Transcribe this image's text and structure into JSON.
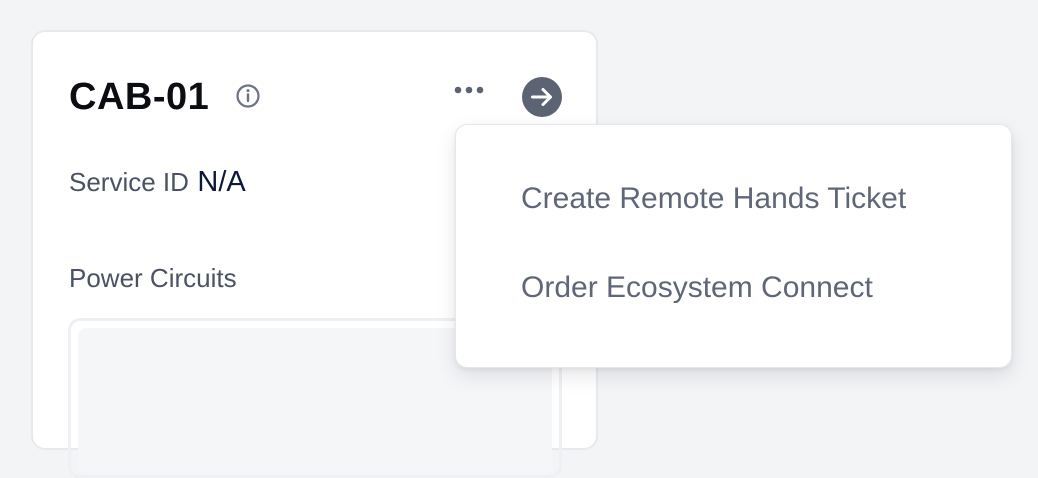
{
  "card": {
    "title": "CAB-01",
    "service_id_label": "Service ID",
    "service_id_value": "N/A",
    "power_circuits_label": "Power Circuits"
  },
  "icons": {
    "info": "info-icon",
    "more": "more-horizontal-icon",
    "arrow": "arrow-right-circle-icon"
  },
  "menu": {
    "items": [
      {
        "label": "Create Remote Hands Ticket"
      },
      {
        "label": "Order Ecosystem Connect"
      }
    ]
  },
  "colors": {
    "page_background": "#f3f4f6",
    "title": "#0b0d12",
    "label": "#4a5263",
    "value": "#0c1838",
    "menu_text": "#5f6678",
    "arrow_button": "#5c6474"
  }
}
